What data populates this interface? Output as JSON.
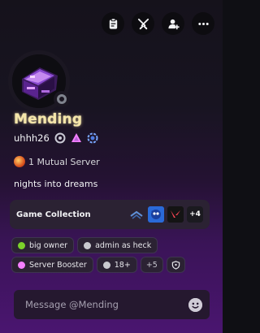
{
  "header": {
    "buttons": [
      {
        "name": "clipboard-icon"
      },
      {
        "name": "swords-icon"
      },
      {
        "name": "add-friend-icon"
      },
      {
        "name": "more-icon"
      }
    ]
  },
  "profile": {
    "display_name": "Mending",
    "username": "uhhh26",
    "status": "offline",
    "mutual_servers": "1 Mutual Server",
    "bio": "nights into dreams"
  },
  "collection": {
    "label": "Game Collection",
    "games": [
      {
        "name": "game-icon-1",
        "color": "#1a2b5c"
      },
      {
        "name": "game-icon-sonic",
        "color": "#1f5fd1"
      },
      {
        "name": "game-icon-valorant",
        "color": "#121212"
      }
    ],
    "more": "+4"
  },
  "roles": {
    "items": [
      {
        "label": "big owner",
        "color": "#7bd12a"
      },
      {
        "label": "admin as heck",
        "color": "#c9c9cf"
      },
      {
        "label": "Server Booster",
        "color": "#f47fff"
      },
      {
        "label": "18+",
        "color": "#c9c9cf"
      }
    ],
    "more": "+5"
  },
  "message": {
    "placeholder": "Message @Mending"
  }
}
